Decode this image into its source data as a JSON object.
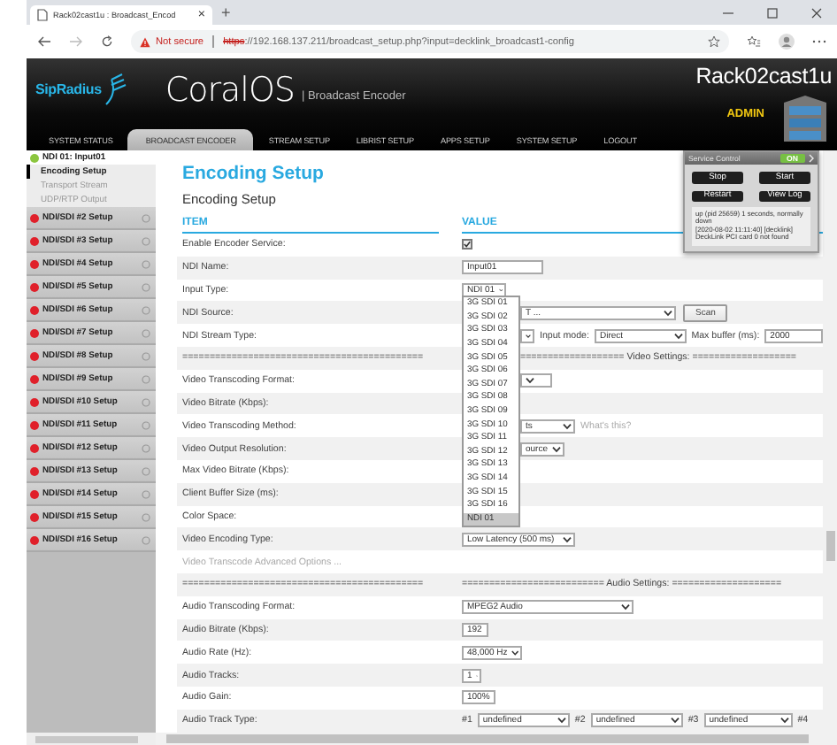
{
  "browser": {
    "tab_title": "Rack02cast1u : Broadcast_Encod",
    "tab_close": "×",
    "new_tab": "+",
    "security_label": "Not secure",
    "url_scheme": "https",
    "url_rest": "://192.168.137.211/broadcast_setup.php?input=decklink_broadcast1-config"
  },
  "header": {
    "logo": "SipRadius",
    "product": "CoralOS",
    "subtitle": "| Broadcast Encoder",
    "hostname": "Rack02cast1u",
    "user": "ADMIN"
  },
  "nav": [
    {
      "label": "SYSTEM STATUS",
      "selected": false
    },
    {
      "label": "BROADCAST ENCODER",
      "selected": true
    },
    {
      "label": "STREAM SETUP",
      "selected": false
    },
    {
      "label": "LIBRIST SETUP",
      "selected": false
    },
    {
      "label": "APPS SETUP",
      "selected": false
    },
    {
      "label": "SYSTEM SETUP",
      "selected": false
    },
    {
      "label": "LOGOUT",
      "selected": false
    }
  ],
  "sidebar": {
    "items": [
      {
        "label": "NDI 01: Input01",
        "color": "#8cc63f",
        "expanded": true,
        "children": [
          {
            "label": "Encoding Setup",
            "selected": true
          },
          {
            "label": "Transport Stream",
            "selected": false
          },
          {
            "label": "UDP/RTP Output",
            "selected": false
          }
        ]
      },
      {
        "label": "NDI/SDI #2 Setup",
        "color": "#e0202a",
        "expanded": false
      },
      {
        "label": "NDI/SDI #3 Setup",
        "color": "#e0202a",
        "expanded": false
      },
      {
        "label": "NDI/SDI #4 Setup",
        "color": "#e0202a",
        "expanded": false
      },
      {
        "label": "NDI/SDI #5 Setup",
        "color": "#e0202a",
        "expanded": false
      },
      {
        "label": "NDI/SDI #6 Setup",
        "color": "#e0202a",
        "expanded": false
      },
      {
        "label": "NDI/SDI #7 Setup",
        "color": "#e0202a",
        "expanded": false
      },
      {
        "label": "NDI/SDI #8 Setup",
        "color": "#e0202a",
        "expanded": false
      },
      {
        "label": "NDI/SDI #9 Setup",
        "color": "#e0202a",
        "expanded": false
      },
      {
        "label": "NDI/SDI #10 Setup",
        "color": "#e0202a",
        "expanded": false
      },
      {
        "label": "NDI/SDI #11 Setup",
        "color": "#e0202a",
        "expanded": false
      },
      {
        "label": "NDI/SDI #12 Setup",
        "color": "#e0202a",
        "expanded": false
      },
      {
        "label": "NDI/SDI #13 Setup",
        "color": "#e0202a",
        "expanded": false
      },
      {
        "label": "NDI/SDI #14 Setup",
        "color": "#e0202a",
        "expanded": false
      },
      {
        "label": "NDI/SDI #15 Setup",
        "color": "#e0202a",
        "expanded": false
      },
      {
        "label": "NDI/SDI #16 Setup",
        "color": "#e0202a",
        "expanded": false
      }
    ]
  },
  "page": {
    "title": "Encoding Setup",
    "section": "Encoding Setup",
    "columns": [
      "ITEM",
      "VALUE"
    ]
  },
  "rows": [
    {
      "kind": "field",
      "label": "Enable Encoder Service:",
      "controls": [
        {
          "kind": "checkbox",
          "checked": true
        }
      ]
    },
    {
      "kind": "field",
      "label": "NDI Name:",
      "controls": [
        {
          "kind": "input",
          "value": "Input01"
        }
      ]
    },
    {
      "kind": "field",
      "label": "Input Type:",
      "controls": [
        {
          "kind": "select",
          "value": "NDI 01",
          "open": true
        }
      ]
    },
    {
      "kind": "field",
      "label": "NDI Source:",
      "controls": [
        {
          "kind": "select",
          "value": "T ..."
        },
        {
          "kind": "button",
          "value": "Scan"
        }
      ]
    },
    {
      "kind": "field",
      "label": "NDI Stream Type:",
      "controls": [
        {
          "kind": "select"
        },
        {
          "kind": "text",
          "value": "Input mode:"
        },
        {
          "kind": "select",
          "value": "Direct"
        },
        {
          "kind": "text",
          "value": "Max buffer (ms):"
        },
        {
          "kind": "input",
          "value": "2000"
        }
      ]
    },
    {
      "kind": "separator",
      "label": "============================================",
      "controls": [
        {
          "kind": "text",
          "value": "=================== Video Settings: ==================="
        }
      ]
    },
    {
      "kind": "field",
      "label": "Video Transcoding Format:",
      "controls": [
        {
          "kind": "select"
        }
      ]
    },
    {
      "kind": "field",
      "label": "Video Bitrate (Kbps):"
    },
    {
      "kind": "field",
      "label": "Video Transcoding Method:",
      "controls": [
        {
          "kind": "select",
          "value": "ts"
        },
        {
          "kind": "link",
          "value": "What's this?"
        }
      ]
    },
    {
      "kind": "field",
      "label": "Video Output Resolution:",
      "controls": [
        {
          "kind": "select",
          "value": "ource"
        }
      ]
    },
    {
      "kind": "field",
      "label": "Max Video Bitrate (Kbps):"
    },
    {
      "kind": "field",
      "label": "Client Buffer Size (ms):"
    },
    {
      "kind": "field",
      "label": "Color Space:"
    },
    {
      "kind": "field",
      "label": "Video Encoding Type:",
      "controls": [
        {
          "kind": "select",
          "value": "Low Latency (500 ms)"
        }
      ]
    },
    {
      "kind": "link",
      "label": "Video Transcode Advanced Options ..."
    },
    {
      "kind": "separator",
      "label": "============================================",
      "controls": [
        {
          "kind": "text",
          "value": "========================== Audio Settings: ===================="
        }
      ]
    },
    {
      "kind": "field",
      "label": "Audio Transcoding Format:",
      "controls": [
        {
          "kind": "select",
          "value": "MPEG2 Audio"
        }
      ]
    },
    {
      "kind": "field",
      "label": "Audio Bitrate (Kbps):",
      "controls": [
        {
          "kind": "input",
          "value": "192"
        }
      ]
    },
    {
      "kind": "field",
      "label": "Audio Rate (Hz):",
      "controls": [
        {
          "kind": "select",
          "value": "48,000 Hz"
        }
      ]
    },
    {
      "kind": "field",
      "label": "Audio Tracks:",
      "controls": [
        {
          "kind": "select",
          "value": "1"
        }
      ]
    },
    {
      "kind": "field",
      "label": "Audio Gain:",
      "controls": [
        {
          "kind": "select",
          "value": "100%"
        }
      ]
    },
    {
      "kind": "field",
      "label": "Audio Track Type:",
      "controls": [
        {
          "kind": "text",
          "value": "#1"
        },
        {
          "kind": "select",
          "value": "undefined"
        },
        {
          "kind": "text",
          "value": "#2"
        },
        {
          "kind": "select",
          "value": "undefined"
        },
        {
          "kind": "text",
          "value": "#3"
        },
        {
          "kind": "select",
          "value": "undefined"
        },
        {
          "kind": "text",
          "value": "#4"
        }
      ]
    }
  ],
  "dropdown": {
    "items": [
      {
        "label": "3G SDI 01",
        "selected": false
      },
      {
        "label": "3G SDI 02",
        "selected": false
      },
      {
        "label": "3G SDI 03",
        "selected": false
      },
      {
        "label": "3G SDI 04",
        "selected": false
      },
      {
        "label": "3G SDI 05",
        "selected": false
      },
      {
        "label": "3G SDI 06",
        "selected": false
      },
      {
        "label": "3G SDI 07",
        "selected": false
      },
      {
        "label": "3G SDI 08",
        "selected": false
      },
      {
        "label": "3G SDI 09",
        "selected": false
      },
      {
        "label": "3G SDI 10",
        "selected": false
      },
      {
        "label": "3G SDI 11",
        "selected": false
      },
      {
        "label": "3G SDI 12",
        "selected": false
      },
      {
        "label": "3G SDI 13",
        "selected": false
      },
      {
        "label": "3G SDI 14",
        "selected": false
      },
      {
        "label": "3G SDI 15",
        "selected": false
      },
      {
        "label": "3G SDI 16",
        "selected": false
      },
      {
        "label": "NDI 01",
        "selected": true
      }
    ]
  },
  "service_panel": {
    "title": "Service Control",
    "status": "ON",
    "on": true,
    "buttons": [
      "Stop",
      "Start",
      "Restart",
      "View Log"
    ],
    "log": [
      "up (pid 25659) 1 seconds, normally down",
      "[2020-08-02 11:11:40] [decklink] DeckLink PCI card 0 not found"
    ]
  }
}
